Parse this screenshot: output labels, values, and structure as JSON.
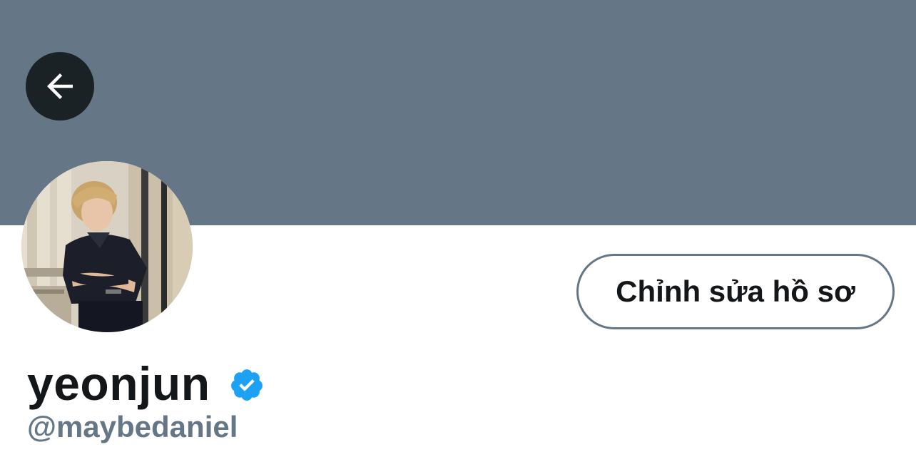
{
  "profile": {
    "display_name": "yeonjun",
    "handle": "@maybedaniel",
    "verified": true,
    "edit_button_label": "Chỉnh sửa hồ sơ"
  },
  "icons": {
    "back": "back-arrow-icon",
    "verified": "verified-badge-icon"
  },
  "colors": {
    "banner": "#657786",
    "back_button_bg": "#1b2226",
    "verified": "#1da1f2",
    "text_primary": "#14171a",
    "text_secondary": "#657786"
  }
}
